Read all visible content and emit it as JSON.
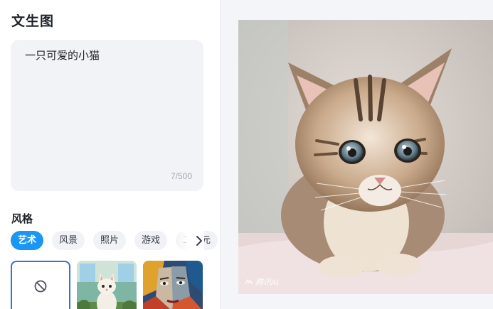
{
  "page": {
    "title": "文生图"
  },
  "prompt": {
    "value": "一只可爱的小猫",
    "count": "7/500"
  },
  "style_section": {
    "label": "风格",
    "tabs": [
      {
        "label": "艺术",
        "active": true
      },
      {
        "label": "风景",
        "active": false
      },
      {
        "label": "照片",
        "active": false
      },
      {
        "label": "游戏",
        "active": false
      },
      {
        "label": "二次元",
        "active": false
      }
    ],
    "thumbnails": [
      {
        "name": "none",
        "icon": "no-style-icon",
        "selected": true
      },
      {
        "name": "cartoon-cat",
        "selected": false
      },
      {
        "name": "cubist-face",
        "selected": false
      }
    ]
  },
  "result": {
    "watermark": "腾讯AI"
  },
  "colors": {
    "accent": "#1a96f5",
    "selected_border": "#3a6fd6",
    "prompt_bg": "#f2f3f7",
    "panel_bg": "#f4f5f9"
  }
}
